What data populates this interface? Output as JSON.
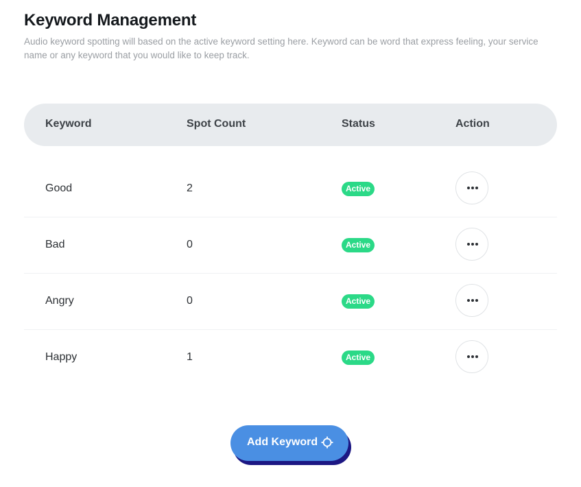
{
  "page": {
    "title": "Keyword Management",
    "description": "Audio keyword spotting will based on the active keyword setting here. Keyword can be word that express feeling, your service name or any keyword that you would like to keep track."
  },
  "table": {
    "headers": {
      "keyword": "Keyword",
      "spot_count": "Spot Count",
      "status": "Status",
      "action": "Action"
    },
    "rows": [
      {
        "keyword": "Good",
        "spot_count": "2",
        "status": "Active"
      },
      {
        "keyword": "Bad",
        "spot_count": "0",
        "status": "Active"
      },
      {
        "keyword": "Angry",
        "spot_count": "0",
        "status": "Active"
      },
      {
        "keyword": "Happy",
        "spot_count": "1",
        "status": "Active"
      }
    ]
  },
  "add_button": {
    "label": "Add Keyword",
    "icon": "crosshair-icon"
  },
  "icons": {
    "row_action": "more-horizontal-icon"
  },
  "colors": {
    "status_active": "#2bd987",
    "primary_button": "#4a8fe3",
    "button_shadow": "#1c1783",
    "header_bg": "#e8ebee"
  }
}
